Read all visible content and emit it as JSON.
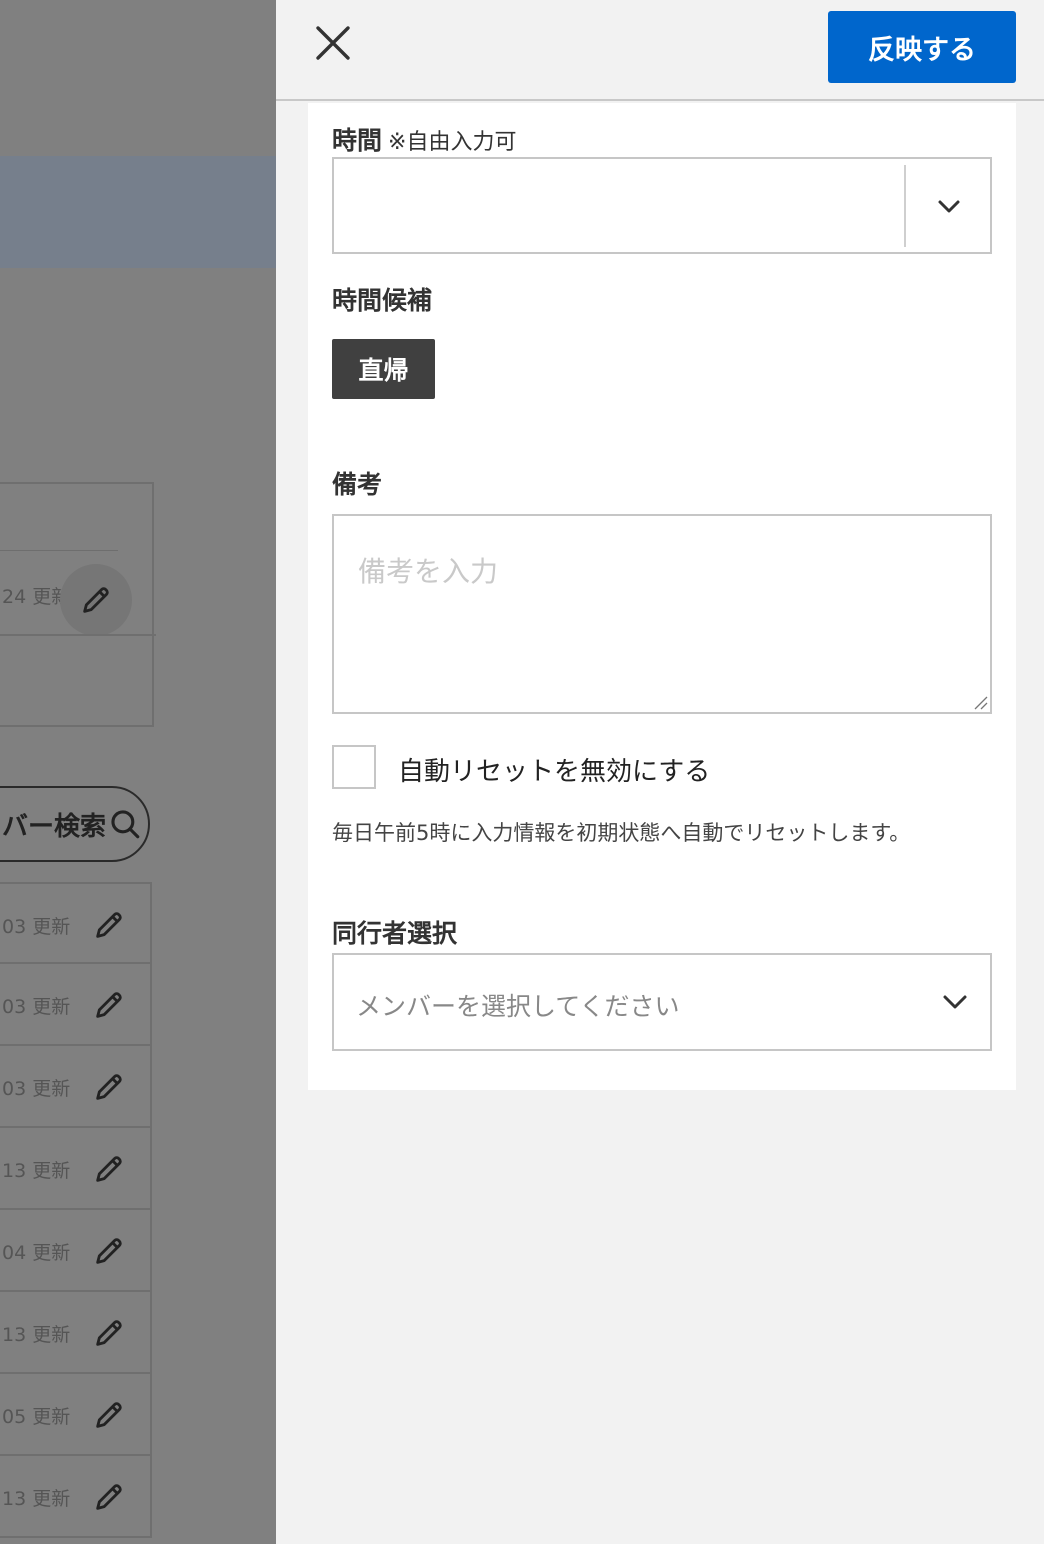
{
  "background": {
    "card_text": "24 更新",
    "search_label": "バー検索",
    "rows": [
      {
        "label": "03 更新"
      },
      {
        "label": "03 更新"
      },
      {
        "label": "03 更新"
      },
      {
        "label": "13 更新"
      },
      {
        "label": "04 更新"
      },
      {
        "label": "13 更新"
      },
      {
        "label": "05 更新"
      },
      {
        "label": "13 更新"
      }
    ]
  },
  "panel": {
    "apply_label": "反映する",
    "time": {
      "label": "時間",
      "note": "※自由入力可",
      "value": ""
    },
    "candidates": {
      "label": "時間候補",
      "chips": [
        "直帰"
      ]
    },
    "memo": {
      "label": "備考",
      "placeholder": "備考を入力"
    },
    "auto_reset": {
      "label": "自動リセットを無効にする",
      "checked": false,
      "help": "毎日午前5時に入力情報を初期状態へ自動でリセットします。"
    },
    "companion": {
      "label": "同行者選択",
      "placeholder": "メンバーを選択してください"
    }
  }
}
